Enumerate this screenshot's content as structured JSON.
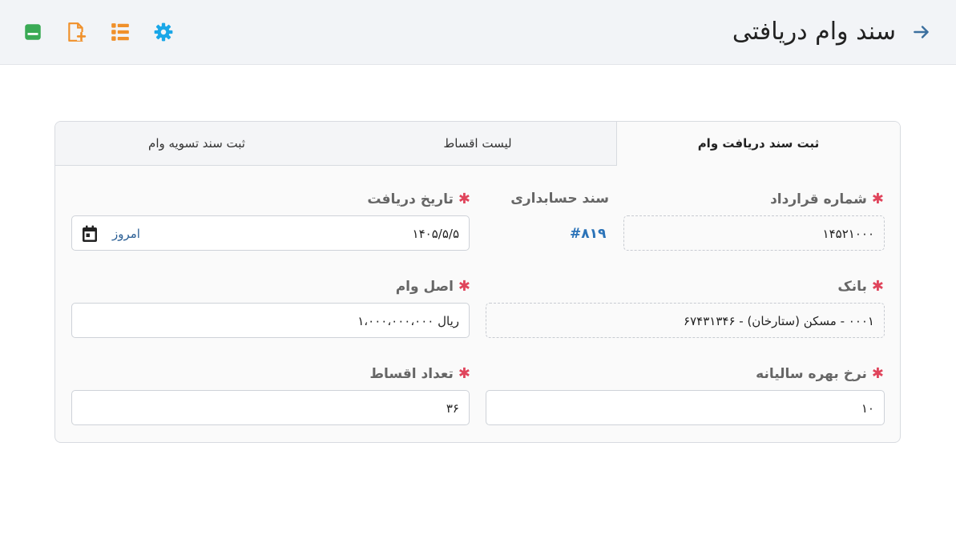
{
  "header": {
    "title": "سند وام دریافتی",
    "icons": {
      "back": "arrow-right-icon",
      "settings": "gear-icon",
      "list": "list-icon",
      "new_doc": "file-plus-icon",
      "save": "save-icon"
    },
    "colors": {
      "settings": "#1aa7e8",
      "list": "#f0902a",
      "new_doc": "#f0902a",
      "save": "#3aaa55",
      "back": "#3b6f9e"
    }
  },
  "tabs": [
    {
      "label": "ثبت سند دریافت وام",
      "active": true
    },
    {
      "label": "لیست اقساط",
      "active": false
    },
    {
      "label": "ثبت سند تسویه وام",
      "active": false
    }
  ],
  "form": {
    "contract_number": {
      "label": "شماره قرارداد",
      "value": "۱۴۵۲۱۰۰۰"
    },
    "accounting_doc": {
      "label": "سند حسابداری",
      "value": "#۸۱۹"
    },
    "receive_date": {
      "label": "تاریخ دریافت",
      "value": "۱۴۰۵/۵/۵",
      "today_label": "امروز"
    },
    "bank": {
      "label": "بانک",
      "value": "۰۰۰۱ - مسکن (ستارخان) - ۶۷۴۳۱۳۴۶"
    },
    "principal": {
      "label": "اصل وام",
      "value": "ریال ۱،۰۰۰،۰۰۰،۰۰۰"
    },
    "interest_rate": {
      "label": "نرخ بهره سالیانه",
      "value": "۱۰"
    },
    "installments": {
      "label": "تعداد اقساط",
      "value": "۳۶"
    },
    "required_mark": "✱"
  }
}
